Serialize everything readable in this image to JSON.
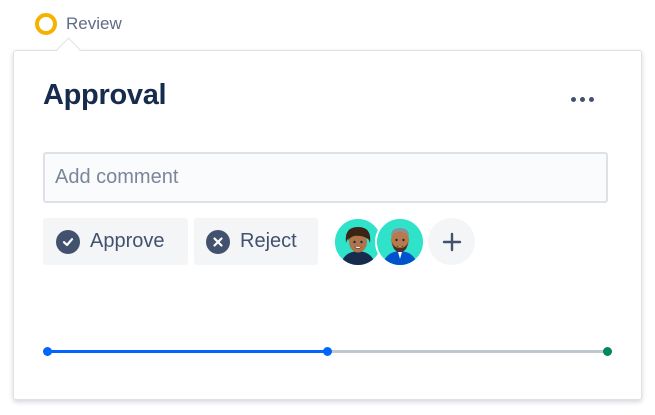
{
  "status": {
    "label": "Review",
    "color": "#f5b301"
  },
  "card": {
    "title": "Approval",
    "more_icon": "more-horizontal-icon"
  },
  "comment": {
    "placeholder": "Add comment",
    "value": ""
  },
  "actions": {
    "approve": {
      "label": "Approve",
      "icon": "check-circle-icon"
    },
    "reject": {
      "label": "Reject",
      "icon": "cross-circle-icon"
    }
  },
  "approvers": [
    {
      "icon": "avatar-woman-icon"
    },
    {
      "icon": "avatar-man-icon"
    }
  ],
  "add_approver": {
    "icon": "plus-icon"
  },
  "progress": {
    "fraction": 0.5,
    "colors": {
      "done": "#0065ff",
      "pending": "#c1c7d0",
      "end": "#00875a"
    }
  }
}
